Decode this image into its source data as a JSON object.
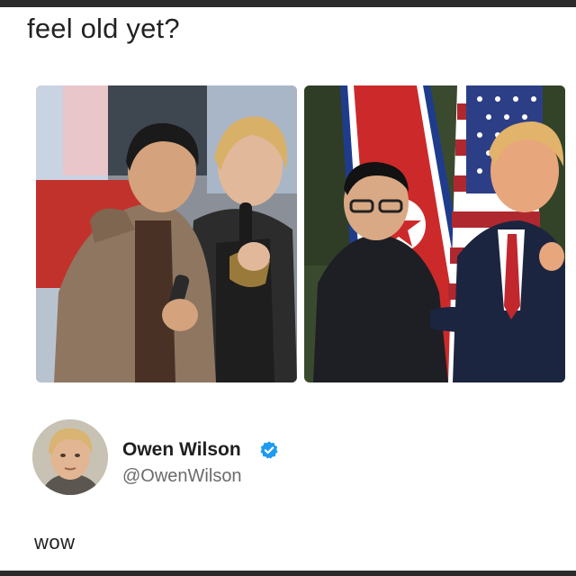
{
  "caption": "feel old yet?",
  "photos": {
    "left": {
      "subject": "left-photo"
    },
    "right": {
      "subject": "right-photo"
    }
  },
  "tweet": {
    "author_name": "Owen Wilson",
    "handle": "@OwenWilson",
    "text": "wow",
    "verified_color": "#1d9bf0"
  }
}
